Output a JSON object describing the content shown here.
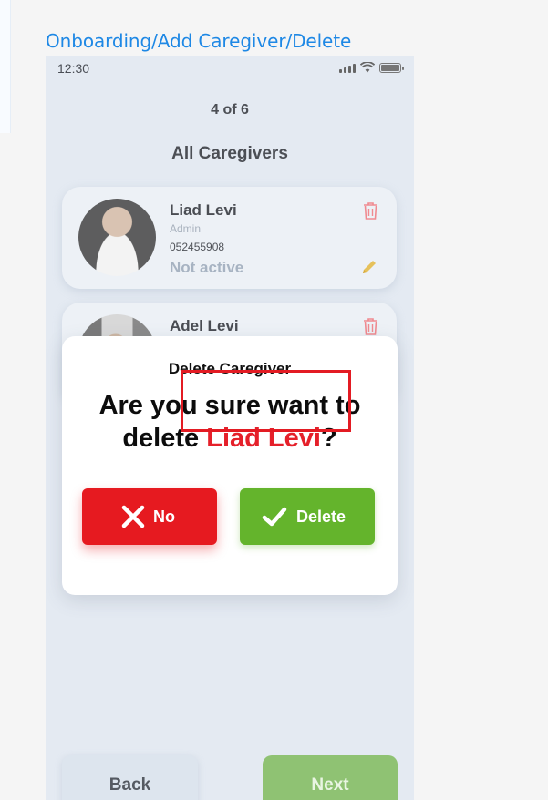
{
  "frame_title": "Onboarding/Add Caregiver/Delete",
  "status_bar": {
    "time": "12:30"
  },
  "step": "4 of 6",
  "section_title": "All Caregivers",
  "caregivers": [
    {
      "name": "Liad Levi",
      "role": "Admin",
      "phone": "052455908",
      "status": "Not active"
    },
    {
      "name": "Adel Levi"
    }
  ],
  "dialog": {
    "title": "Delete Caregiver",
    "question_prefix": "Are you sure want to delete",
    "question_name": "Liad Levi",
    "question_suffix": "?",
    "no_label": "No",
    "delete_label": "Delete"
  },
  "footer": {
    "back_label": "Back",
    "next_label": "Next"
  },
  "colors": {
    "link_blue": "#1e88e5",
    "danger_red": "#e61a20",
    "success_green": "#64b42c",
    "highlight_border": "#e31b23"
  }
}
